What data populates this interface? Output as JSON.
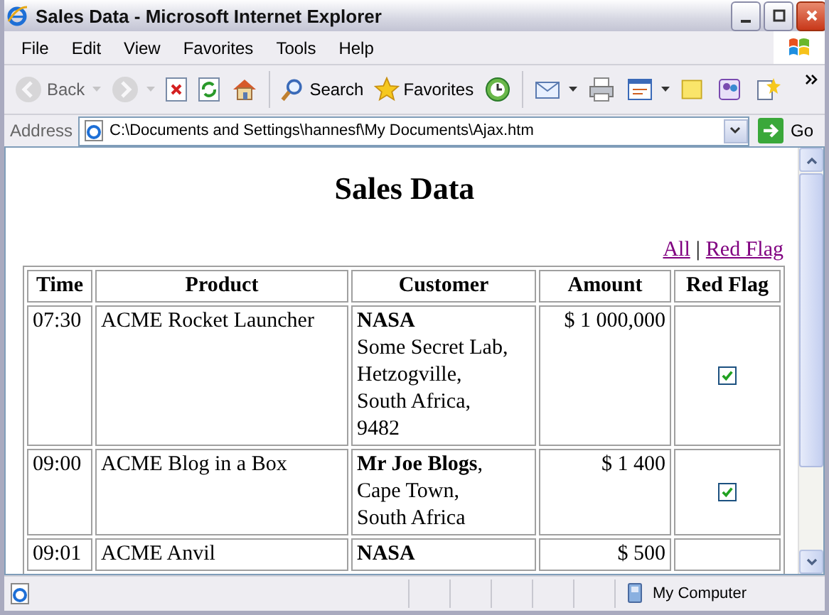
{
  "window": {
    "title": "Sales Data - Microsoft Internet Explorer"
  },
  "menu": [
    "File",
    "Edit",
    "View",
    "Favorites",
    "Tools",
    "Help"
  ],
  "toolbar": [
    {
      "kind": "back",
      "label": "Back",
      "disabled": true,
      "dropdown": true
    },
    {
      "kind": "forward",
      "disabled": true,
      "dropdown": true
    },
    {
      "kind": "stop",
      "disabled": false,
      "dropdown": false
    },
    {
      "kind": "refresh",
      "disabled": false,
      "dropdown": false
    },
    {
      "kind": "home",
      "disabled": false,
      "dropdown": false
    },
    {
      "kind": "search",
      "label": "Search",
      "disabled": false,
      "dropdown": false
    },
    {
      "kind": "favorites",
      "label": "Favorites",
      "disabled": false,
      "dropdown": false
    },
    {
      "kind": "history",
      "disabled": false,
      "dropdown": false
    },
    {
      "kind": "mail",
      "disabled": false,
      "dropdown": true
    },
    {
      "kind": "print",
      "disabled": false,
      "dropdown": false
    },
    {
      "kind": "edit",
      "disabled": false,
      "dropdown": true
    },
    {
      "kind": "note",
      "disabled": false,
      "dropdown": false
    },
    {
      "kind": "messenger",
      "disabled": false,
      "dropdown": false
    },
    {
      "kind": "research",
      "disabled": false,
      "dropdown": false
    }
  ],
  "address": {
    "label": "Address",
    "value": "C:\\Documents and Settings\\hannesf\\My Documents\\Ajax.htm",
    "go": "Go"
  },
  "page": {
    "heading": "Sales Data",
    "filters": [
      "All",
      "Red Flag"
    ],
    "separator": "|",
    "table": {
      "columns": [
        "Time",
        "Product",
        "Customer",
        "Amount",
        "Red Flag"
      ],
      "rows": [
        {
          "time": "07:30",
          "product": "ACME Rocket Launcher",
          "customer": [
            "**NASA**",
            "Some Secret Lab,",
            "Hetzogville,",
            "South Africa,",
            "9482"
          ],
          "amount": "$ 1 000,000",
          "red_flag": {
            "checked": true
          }
        },
        {
          "time": "09:00",
          "product": "ACME Blog in a Box",
          "customer": [
            "**Mr Joe Blogs**,",
            "Cape Town,",
            "South Africa"
          ],
          "amount": "$ 1 400",
          "red_flag": {
            "checked": true
          }
        },
        {
          "time": "09:01",
          "product": "ACME Anvil",
          "customer": [
            "**NASA**"
          ],
          "amount": "$ 500"
        }
      ]
    }
  },
  "status_bar": {
    "zone": "My Computer"
  }
}
